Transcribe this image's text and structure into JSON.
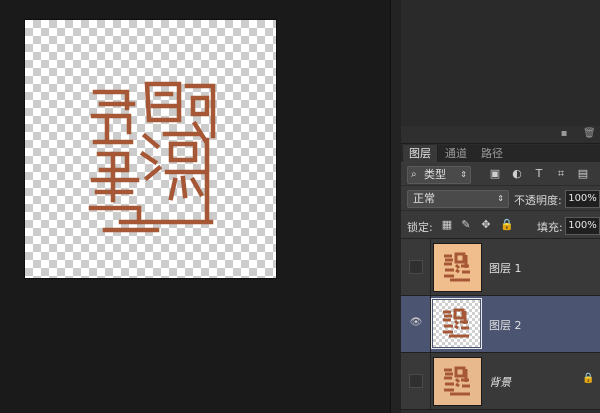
{
  "canvas": {
    "document_colors": {
      "seal": "#a65836",
      "checker_light": "#ffffff",
      "checker_dark": "#cccccc"
    },
    "seal_icon": "seal-stamp-image"
  },
  "panel_footer": {
    "new_layer_icon": "new-layer-icon",
    "trash_icon": "trash-icon"
  },
  "tabs": [
    {
      "label": "图层",
      "active": true
    },
    {
      "label": "通道",
      "active": false
    },
    {
      "label": "路径",
      "active": false
    }
  ],
  "filter": {
    "kind_label": "类型",
    "icons": [
      "image-filter-icon",
      "adjustment-filter-icon",
      "text-filter-icon",
      "shape-filter-icon",
      "smart-object-filter-icon"
    ]
  },
  "blend": {
    "mode": "正常",
    "opacity_label": "不透明度:",
    "opacity_value": "100%"
  },
  "lock": {
    "label": "锁定:",
    "fill_label": "填充:",
    "fill_value": "100%"
  },
  "layers": [
    {
      "name": "图层 1",
      "visible": false,
      "selected": false,
      "thumbnail": "peach-seal"
    },
    {
      "name": "图层 2",
      "visible": true,
      "selected": true,
      "thumbnail": "transparent-seal"
    },
    {
      "name": "背景",
      "visible": false,
      "selected": false,
      "thumbnail": "background-seal",
      "locked": true
    }
  ],
  "colors": {
    "selected_row": "#4b5470",
    "panel": "#393939",
    "thumb_peach": "#f0bd8c"
  }
}
